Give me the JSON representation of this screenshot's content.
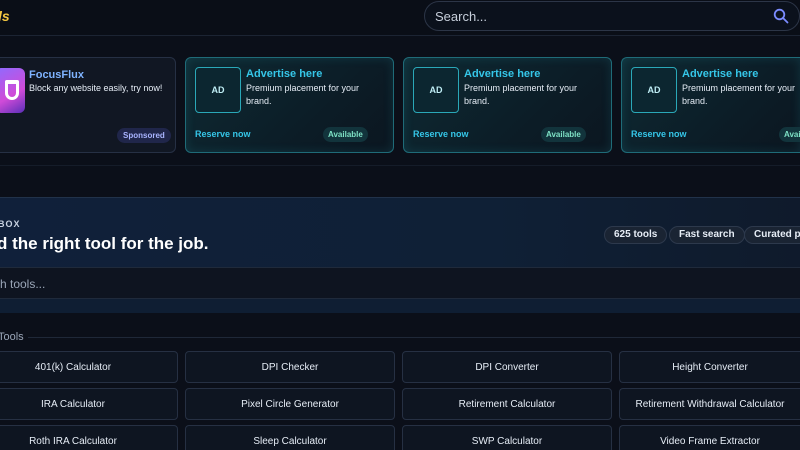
{
  "header": {
    "logo": "ls",
    "search_placeholder": "Search...",
    "search_icon": "search-icon"
  },
  "sponsored": {
    "title": "FocusFlux",
    "description": "Block any website easily, try now!",
    "badge": "Sponsored"
  },
  "ad_slots": [
    {
      "box": "AD",
      "title": "Advertise here",
      "description": "Premium placement for your brand.",
      "reserve": "Reserve now",
      "status": "Available"
    },
    {
      "box": "AD",
      "title": "Advertise here",
      "description": "Premium placement for your brand.",
      "reserve": "Reserve now",
      "status": "Available"
    },
    {
      "box": "AD",
      "title": "Advertise here",
      "description": "Premium placement for your brand.",
      "reserve": "Reserve now",
      "status": "Availa"
    }
  ],
  "hero": {
    "eyebrow": "BOX",
    "headline": "d the right tool for the job.",
    "pills": [
      "625 tools",
      "Fast search",
      "Curated pi"
    ]
  },
  "tool_search": {
    "placeholder": "rch tools..."
  },
  "section": {
    "label": "Tools"
  },
  "tools": [
    "401(k) Calculator",
    "DPI Checker",
    "DPI Converter",
    "Height Converter",
    "IRA Calculator",
    "Pixel Circle Generator",
    "Retirement Calculator",
    "Retirement Withdrawal Calculator",
    "Roth IRA Calculator",
    "Sleep Calculator",
    "SWP Calculator",
    "Video Frame Extractor"
  ],
  "colors": {
    "background": "#0b0f19",
    "accent_cyan": "#35c6e8",
    "logo_yellow": "#f5c842",
    "sponsored_title": "#7fb3ff"
  }
}
